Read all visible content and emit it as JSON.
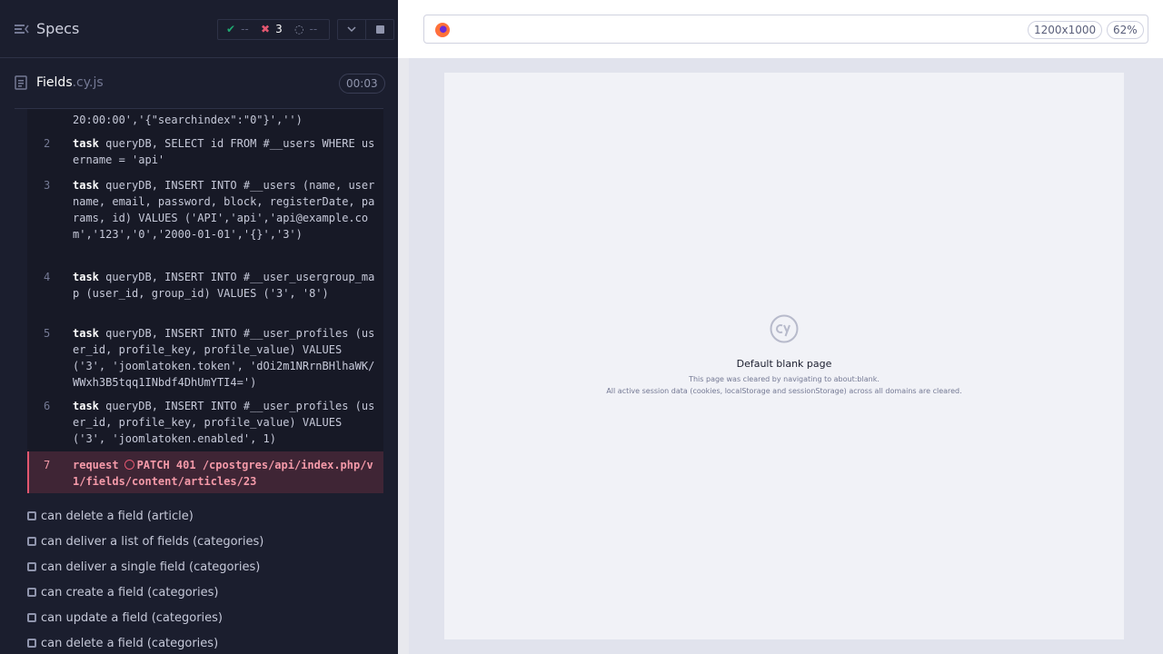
{
  "header": {
    "title": "Specs",
    "stats": {
      "passed": "--",
      "failed": "3",
      "pending": "--"
    }
  },
  "runnable": {
    "spec_base": "Fields",
    "spec_ext": ".cy.js",
    "duration": "00:03"
  },
  "commands": [
    {
      "number": "",
      "name": "",
      "message": "20:00:00','{\"searchindex\":\"0\"}','')"
    },
    {
      "number": "2",
      "name": "task",
      "message": "queryDB, SELECT id FROM #__users WHERE username = 'api'"
    },
    {
      "number": "3",
      "name": "task",
      "message": "queryDB, INSERT INTO #__users (name, username, email, password, block, registerDate, params, id) VALUES ('API','api','api@example.com','123','0','2000-01-01','{}','3')"
    },
    {
      "number": "4",
      "name": "task",
      "message": "queryDB, INSERT INTO #__user_usergroup_map (user_id, group_id) VALUES ('3', '8')"
    },
    {
      "number": "5",
      "name": "task",
      "message": "queryDB, INSERT INTO #__user_profiles (user_id, profile_key, profile_value) VALUES ('3', 'joomlatoken.token', 'dOi2m1NRrnBHlhaWK/WWxh3B5tqq1INbdf4DhUmYTI4=')"
    },
    {
      "number": "6",
      "name": "task",
      "message": "queryDB, INSERT INTO #__user_profiles (user_id, profile_key, profile_value) VALUES ('3', 'joomlatoken.enabled', 1)"
    },
    {
      "number": "7",
      "name": "request",
      "message": "PATCH 401 /cpostgres/api/index.php/v1/fields/content/articles/23"
    }
  ],
  "tests": [
    "can delete a field (article)",
    "can deliver a list of fields (categories)",
    "can deliver a single field (categories)",
    "can create a field (categories)",
    "can update a field (categories)",
    "can delete a field (categories)"
  ],
  "aut": {
    "viewport": "1200x1000",
    "zoom": "62%",
    "blank_title": "Default blank page",
    "blank_line1": "This page was cleared by navigating to about:blank.",
    "blank_line2": "All active session data (cookies, localStorage and sessionStorage) across all domains are cleared."
  },
  "colors": {
    "reporter_bg": "#1b1e2e",
    "pass": "#1fa971",
    "fail": "#e45770",
    "aut_bg": "#e1e3ed"
  },
  "icons": [
    "specs-menu-icon",
    "check-icon",
    "x-icon",
    "spinner-icon",
    "chevron-down-icon",
    "stop-icon",
    "file-icon",
    "error-ring-icon",
    "checkbox-icon",
    "browser-icon",
    "cypress-logo-icon"
  ]
}
